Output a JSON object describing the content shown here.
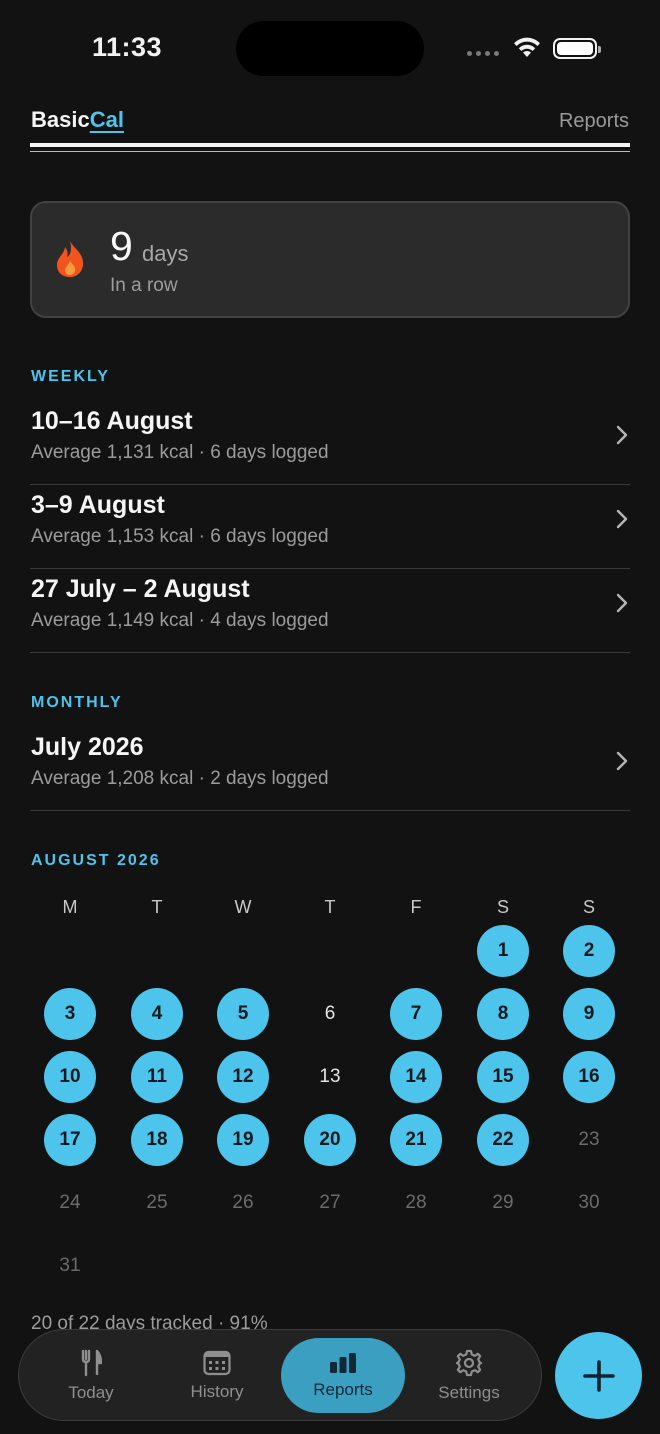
{
  "status_bar": {
    "time": "11:33"
  },
  "header": {
    "brand_part1": "Basic",
    "brand_part2": "Cal",
    "reports_link": "Reports"
  },
  "streak": {
    "count": "9",
    "unit": "days",
    "subtitle": "In a row"
  },
  "weekly": {
    "label": "WEEKLY",
    "items": [
      {
        "title": "10–16 August",
        "subtitle": "Average 1,131 kcal · 6 days logged"
      },
      {
        "title": "3–9 August",
        "subtitle": "Average 1,153 kcal · 6 days logged"
      },
      {
        "title": "27 July – 2 August",
        "subtitle": "Average 1,149 kcal · 4 days logged"
      }
    ]
  },
  "monthly": {
    "label": "MONTHLY",
    "items": [
      {
        "title": "July 2026",
        "subtitle": "Average 1,208 kcal · 2 days logged"
      }
    ]
  },
  "calendar": {
    "label": "AUGUST 2026",
    "weekdays": [
      "M",
      "T",
      "W",
      "T",
      "F",
      "S",
      "S"
    ],
    "first_weekday_index": 5,
    "days_in_month": 31,
    "today": 22,
    "logged_days": [
      1,
      2,
      3,
      4,
      5,
      7,
      8,
      9,
      10,
      11,
      12,
      14,
      15,
      16,
      17,
      18,
      19,
      20,
      21,
      22
    ],
    "summary": "20 of 22 days tracked · 91%"
  },
  "tabs": [
    {
      "label": "Today",
      "icon": "fork-knife-icon",
      "active": false
    },
    {
      "label": "History",
      "icon": "calendar-icon",
      "active": false
    },
    {
      "label": "Reports",
      "icon": "bar-chart-icon",
      "active": true
    },
    {
      "label": "Settings",
      "icon": "gear-icon",
      "active": false
    }
  ],
  "colors": {
    "accent": "#4cc4ec",
    "background": "#131212",
    "card": "#2c2b2b",
    "active_tab": "#3b9fc1"
  }
}
